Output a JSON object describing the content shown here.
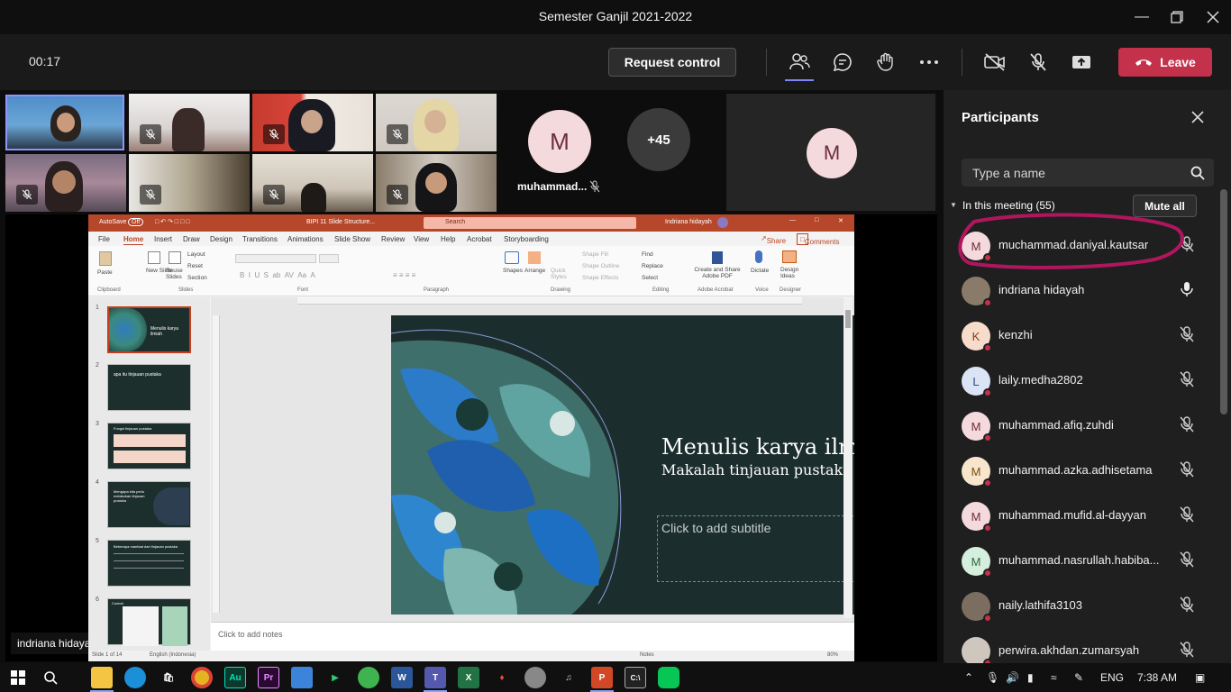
{
  "window": {
    "title": "Semester Ganjil 2021-2022"
  },
  "meeting_bar": {
    "timer": "00:17",
    "request_control": "Request control",
    "leave": "Leave"
  },
  "video_strip": {
    "named_avatar": {
      "initial": "M",
      "name": "muhammad..."
    },
    "overflow_count": "+45",
    "spotlight_initial": "M",
    "presenter_label": "indriana hidayah"
  },
  "ppt": {
    "autosave": "AutoSave",
    "autosave_state": "Off",
    "file_name": "BIPI 11 Slide Structure...",
    "search": "Search",
    "user": "Indriana hidayah",
    "menu": [
      "File",
      "Home",
      "Insert",
      "Draw",
      "Design",
      "Transitions",
      "Animations",
      "Slide Show",
      "Review",
      "View",
      "Help",
      "Acrobat",
      "Storyboarding"
    ],
    "share": "Share",
    "comments": "Comments",
    "ribbon_groups": [
      "Clipboard",
      "Slides",
      "Font",
      "Paragraph",
      "Drawing",
      "Editing",
      "Adobe Acrobat",
      "Voice",
      "Designer"
    ],
    "ribbon_items": {
      "paste": "Paste",
      "new_slide": "New Slide",
      "reuse_slides": "Reuse Slides",
      "layout": "Layout",
      "reset": "Reset",
      "section": "Section",
      "shapes": "Shapes",
      "arrange": "Arrange",
      "quick_styles": "Quick Styles",
      "shape_fill": "Shape Fill",
      "shape_outline": "Shape Outline",
      "shape_effects": "Shape Effects",
      "find": "Find",
      "replace": "Replace",
      "select": "Select",
      "create_share": "Create and Share Adobe PDF",
      "dictate": "Dictate",
      "design_ideas": "Design Ideas"
    },
    "thumbnails": [
      {
        "num": "1",
        "text": "Menulis karya ilmiah"
      },
      {
        "num": "2",
        "text": "apa itu tinjauan pustaka"
      },
      {
        "num": "3",
        "text": "Fungsi tinjauan pustaka"
      },
      {
        "num": "4",
        "text": "Mengapa kita perlu melakukan tinjauan pustaka"
      },
      {
        "num": "5",
        "text": "Beberapa manfaat dari tinjauan pustaka"
      },
      {
        "num": "6",
        "text": "Contoh"
      }
    ],
    "slide": {
      "title": "Menulis karya ilmiah",
      "subtitle": "Makalah tinjauan pustaka",
      "placeholder": "Click to add subtitle"
    },
    "notes_placeholder": "Click to add notes",
    "status": {
      "slide_count": "Slide 1 of 14",
      "language": "English (Indonesia)",
      "notes": "Notes",
      "zoom": "80%"
    }
  },
  "participants": {
    "title": "Participants",
    "search_placeholder": "Type a name",
    "section": "In this meeting (55)",
    "mute_all": "Mute all",
    "list": [
      {
        "initial": "M",
        "name": "muchammad.daniyal.kautsar",
        "bg": "#f4d9dd",
        "fg": "#6b2f38",
        "mic": "muted"
      },
      {
        "initial": "",
        "name": "indriana hidayah",
        "bg": "#8a7a6a",
        "fg": "#fff",
        "mic": "on"
      },
      {
        "initial": "K",
        "name": "kenzhi",
        "bg": "#f8dccb",
        "fg": "#8a3d12",
        "mic": "muted"
      },
      {
        "initial": "L",
        "name": "laily.medha2802",
        "bg": "#dbe4f5",
        "fg": "#2b4a8a",
        "mic": "muted"
      },
      {
        "initial": "M",
        "name": "muhammad.afiq.zuhdi",
        "bg": "#f4d9dd",
        "fg": "#6b2f38",
        "mic": "muted"
      },
      {
        "initial": "M",
        "name": "muhammad.azka.adhisetama",
        "bg": "#f7e6cc",
        "fg": "#7a4d0f",
        "mic": "muted"
      },
      {
        "initial": "M",
        "name": "muhammad.mufid.al-dayyan",
        "bg": "#f4d9dd",
        "fg": "#6b2f38",
        "mic": "muted"
      },
      {
        "initial": "M",
        "name": "muhammad.nasrullah.habiba...",
        "bg": "#d5eedd",
        "fg": "#2b6b3f",
        "mic": "muted"
      },
      {
        "initial": "",
        "name": "naily.lathifa3103",
        "bg": "#7b6e60",
        "fg": "#fff",
        "mic": "muted"
      },
      {
        "initial": "",
        "name": "perwira.akhdan.zumarsyah",
        "bg": "#cfc7bd",
        "fg": "#fff",
        "mic": "muted"
      }
    ]
  },
  "taskbar": {
    "language": "ENG",
    "time": "7:38 AM"
  },
  "colors": {
    "leave": "#c4314b",
    "ppt_brand": "#b7472a",
    "annotation": "#b0165e"
  }
}
